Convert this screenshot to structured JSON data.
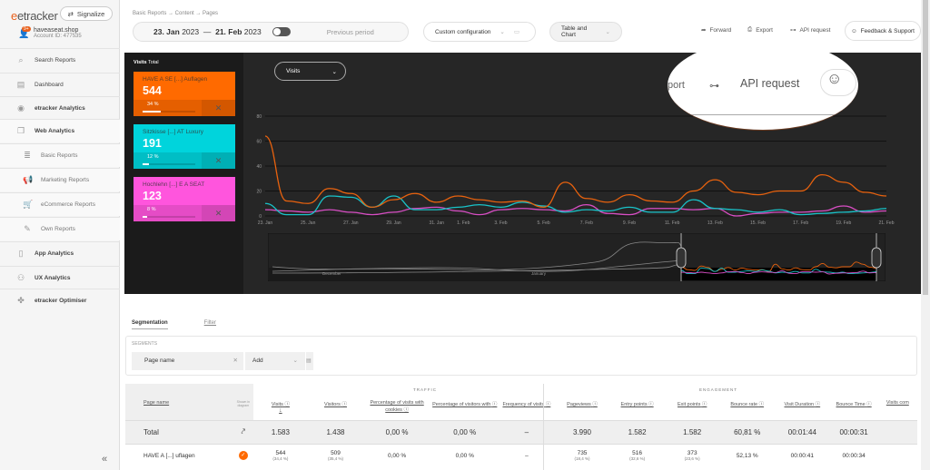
{
  "brand": {
    "logo": "etracker",
    "signalize": "Signalize",
    "account_name": "haveaseat.shop",
    "account_id": "Account ID: 477535",
    "notifications": "9+"
  },
  "sidebar": {
    "items": [
      {
        "label": "Search Reports",
        "icon": "search-icon"
      },
      {
        "label": "Dashboard",
        "icon": "dashboard-icon"
      },
      {
        "label": "etracker Analytics",
        "icon": "analytics-icon"
      },
      {
        "label": "Web Analytics",
        "icon": "window-icon"
      },
      {
        "label": "Basic Reports",
        "icon": "database-icon"
      },
      {
        "label": "Marketing Reports",
        "icon": "megaphone-icon"
      },
      {
        "label": "eCommerce Reports",
        "icon": "cart-icon"
      },
      {
        "label": "Own Reports",
        "icon": "pencil-icon"
      },
      {
        "label": "App Analytics",
        "icon": "phone-icon"
      },
      {
        "label": "UX Analytics",
        "icon": "ux-icon"
      },
      {
        "label": "etracker Optimiser",
        "icon": "optimiser-icon"
      }
    ],
    "collapse": "«"
  },
  "header": {
    "breadcrumb": "Basic Reports → Content → Pages",
    "date_from": "23. Jan",
    "year_from": "2023",
    "date_to": "21. Feb",
    "year_to": "2023",
    "dash": "—",
    "compare": "Previous period",
    "config": "Custom configuration",
    "view": "Table and Chart",
    "forward": "Forward",
    "export": "Export",
    "api": "API request",
    "feedback": "Feedback & Support"
  },
  "magnifier": {
    "export_partial": "port",
    "api": "API request"
  },
  "chart_panel": {
    "title": "Visits",
    "title_sub": "Total",
    "metric": "Visits",
    "cards": [
      {
        "label": "HAVE A SE [...] Auflagen",
        "value": "544",
        "pct": "34 %",
        "fill": 0.34,
        "color": "#ff6a00"
      },
      {
        "label": "Sitzkisse [...] AT Luxury",
        "value": "191",
        "pct": "12 %",
        "fill": 0.12,
        "color": "#00d4dc"
      },
      {
        "label": "Hochlehn [...] E A SEAT",
        "value": "123",
        "pct": "8 %",
        "fill": 0.08,
        "color": "#ff55dd"
      }
    ],
    "navigator_labels": [
      "December",
      "January"
    ]
  },
  "chart_data": {
    "type": "line",
    "ylim": [
      0,
      80
    ],
    "yticks": [
      0,
      20,
      40,
      60,
      80
    ],
    "grid": true,
    "dates": [
      "23. Jan",
      "24. Jan",
      "25. Jan",
      "26. Jan",
      "27. Jan",
      "28. Jan",
      "29. Jan",
      "30. Jan",
      "31. Jan",
      "1. Feb",
      "2. Feb",
      "3. Feb",
      "4. Feb",
      "5. Feb",
      "6. Feb",
      "7. Feb",
      "8. Feb",
      "9. Feb",
      "10. Feb",
      "11. Feb",
      "12. Feb",
      "13. Feb",
      "14. Feb",
      "15. Feb",
      "16. Feb",
      "17. Feb",
      "18. Feb",
      "19. Feb",
      "20. Feb",
      "21. Feb"
    ],
    "xtick_labels": [
      "23. Jan",
      "25. Jan",
      "27. Jan",
      "29. Jan",
      "31. Jan",
      "1. Feb",
      "3. Feb",
      "5. Feb",
      "7. Feb",
      "9. Feb",
      "11. Feb",
      "13. Feb",
      "15. Feb",
      "17. Feb",
      "19. Feb",
      "21. Feb"
    ],
    "series": [
      {
        "name": "HAVE A SE [...] Auflagen",
        "color": "#e8620e",
        "values": [
          64,
          12,
          10,
          22,
          18,
          7,
          13,
          18,
          11,
          16,
          13,
          11,
          12,
          7,
          27,
          14,
          11,
          17,
          12,
          11,
          20,
          29,
          19,
          17,
          20,
          20,
          33,
          27,
          19,
          16
        ]
      },
      {
        "name": "Sitzkisse [...] AT Luxury",
        "color": "#19c3c9",
        "values": [
          10,
          1,
          1,
          16,
          15,
          7,
          16,
          5,
          5,
          7,
          9,
          7,
          11,
          8,
          3,
          5,
          4,
          7,
          3,
          3,
          13,
          6,
          5,
          3,
          5,
          1,
          2,
          3,
          4,
          6
        ]
      },
      {
        "name": "Hochlehn [...] E A SEAT",
        "color": "#d84ec4",
        "values": [
          5,
          4,
          3,
          5,
          3,
          1,
          3,
          6,
          7,
          4,
          1,
          5,
          6,
          5,
          4,
          9,
          2,
          1,
          6,
          6,
          5,
          6,
          0,
          2,
          3,
          3,
          4,
          8,
          3,
          4
        ]
      }
    ]
  },
  "segmentation": {
    "tab_seg": "Segmentation",
    "tab_filter": "Filter",
    "segments_label": "SEGMENTS",
    "segment": "Page name",
    "add": "Add"
  },
  "table": {
    "group_traffic": "TRAFFIC",
    "group_engagement": "ENGAGEMENT",
    "dimension": "Page name",
    "show_in_diagram": "Shown in diagram",
    "columns": [
      "Visits",
      "Visitors",
      "Percentage of visits with cookies",
      "Percentage of visitors with",
      "Frequency of visits",
      "Pageviews",
      "Entry points",
      "Exit points",
      "Bounce rate",
      "Visit Duration",
      "Bounce Time",
      "Visits com"
    ],
    "total": {
      "label": "Total",
      "values": [
        "1.583",
        "1.438",
        "0,00 %",
        "0,00 %",
        "–",
        "3.990",
        "1.582",
        "1.582",
        "60,81 %",
        "00:01:44",
        "00:00:31",
        ""
      ]
    },
    "rows": [
      {
        "label": "HAVE A [...] uflagen",
        "values": [
          "544",
          "509",
          "0,00 %",
          "0,00 %",
          "–",
          "735",
          "516",
          "373",
          "52,13 %",
          "00:00:41",
          "00:00:34",
          ""
        ],
        "subs": [
          "(34,4 %)",
          "(35,4 %)",
          "",
          "",
          "",
          "(18,4 %)",
          "(32,6 %)",
          "(23,6 %)",
          "",
          "",
          "",
          ""
        ]
      }
    ]
  }
}
